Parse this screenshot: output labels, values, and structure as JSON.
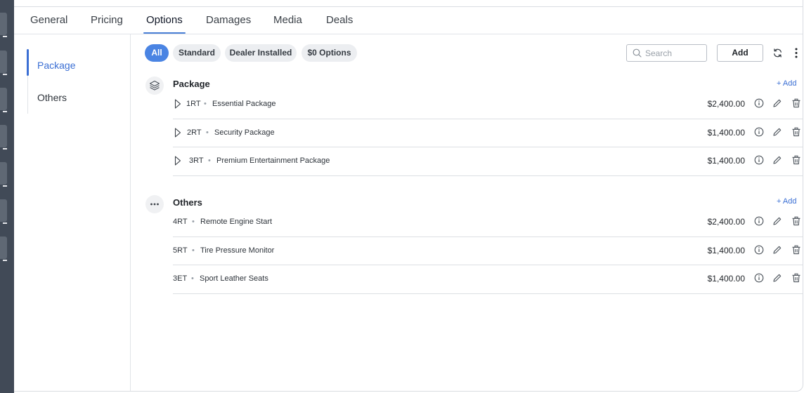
{
  "tabs": [
    {
      "label": "General"
    },
    {
      "label": "Pricing"
    },
    {
      "label": "Options",
      "active": true
    },
    {
      "label": "Damages"
    },
    {
      "label": "Media"
    },
    {
      "label": "Deals"
    }
  ],
  "sidenav": [
    {
      "label": "Package",
      "active": true
    },
    {
      "label": "Others"
    }
  ],
  "filters": [
    {
      "label": "All",
      "active": true
    },
    {
      "label": "Standard"
    },
    {
      "label": "Dealer Installed"
    },
    {
      "label": "$0 Options"
    }
  ],
  "toolbar": {
    "search_placeholder": "Search",
    "search_value": "",
    "add_label": "Add",
    "refresh_icon": "refresh-icon",
    "more_icon": "more-vertical-icon"
  },
  "sections": [
    {
      "title": "Package",
      "icon": "layers-icon",
      "add_label": "+ Add",
      "items": [
        {
          "code": "1RT",
          "name": "Essential Package",
          "price": "$2,400.00"
        },
        {
          "code": "2RT",
          "name": "Security Package",
          "price": "$1,400.00"
        },
        {
          "code": "3RT",
          "name": "Premium Entertainment Package",
          "price": "$1,400.00"
        }
      ]
    },
    {
      "title": "Others",
      "icon": "more-horizontal-icon",
      "add_label": "+ Add",
      "items": [
        {
          "code": "4RT",
          "name": "Remote Engine Start",
          "price": "$2,400.00"
        },
        {
          "code": "5RT",
          "name": "Tire Pressure Monitor",
          "price": "$1,400.00"
        },
        {
          "code": "3ET",
          "name": "Sport Leather Seats",
          "price": "$1,400.00"
        }
      ]
    }
  ],
  "separator": "•",
  "colors": {
    "accent": "#3b6fd4",
    "chip_active": "#4a84e3",
    "chip_bg": "#eceef1",
    "sidebar_dark": "#414a57"
  }
}
